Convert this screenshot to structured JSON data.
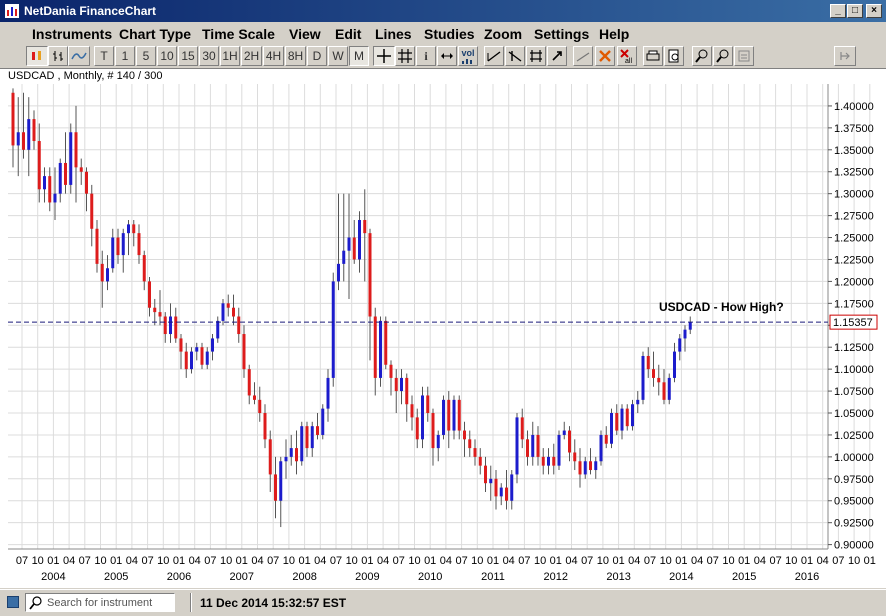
{
  "window": {
    "title": "NetDania FinanceChart"
  },
  "menu": [
    "Instruments",
    "Chart Type",
    "Time Scale",
    "View",
    "Edit",
    "Lines",
    "Studies",
    "Zoom",
    "Settings",
    "Help"
  ],
  "toolbar": {
    "timescale": [
      "T",
      "1",
      "5",
      "10",
      "15",
      "30",
      "1H",
      "2H",
      "4H",
      "8H",
      "D",
      "W",
      "M"
    ],
    "active_timescale": "M",
    "info_label": "i",
    "vol_label": "vol"
  },
  "instrument_label": "USDCAD , Monthly, # 140 / 300",
  "annotation": "USDCAD - How High?",
  "status": {
    "search_placeholder": "Search for instrument",
    "datetime": "11 Dec 2014 15:32:57 EST"
  },
  "colors": {
    "up": "#1c1ccc",
    "down": "#dd1c1c",
    "price_line": "#1a1a7a",
    "grid": "#dcdcdc",
    "price_box_border": "#cc0000"
  },
  "chart_data": {
    "type": "candlestick",
    "symbol": "USDCAD",
    "interval": "Monthly",
    "current_price": "1.15357",
    "y_ticks": [
      "1.40000",
      "1.37500",
      "1.35000",
      "1.32500",
      "1.30000",
      "1.27500",
      "1.25000",
      "1.22500",
      "1.20000",
      "1.17500",
      "1.15000",
      "1.12500",
      "1.10000",
      "1.07500",
      "1.05000",
      "1.02500",
      "1.00000",
      "0.97500",
      "0.95000",
      "0.92500",
      "0.90000"
    ],
    "ylim": [
      0.895,
      1.425
    ],
    "x_month_ticks": [
      "07",
      "10",
      "01",
      "04",
      "07",
      "10",
      "01",
      "04",
      "07",
      "10",
      "01",
      "04",
      "07",
      "10",
      "01",
      "04",
      "07",
      "10",
      "01",
      "04",
      "07",
      "10",
      "01",
      "04",
      "07",
      "10",
      "01",
      "04",
      "07",
      "10",
      "01",
      "04",
      "07",
      "10",
      "01",
      "04",
      "07",
      "10",
      "01",
      "04",
      "07",
      "10",
      "01",
      "04",
      "07",
      "10",
      "01",
      "04",
      "07",
      "10",
      "01",
      "04",
      "07",
      "10",
      "01"
    ],
    "x_year_ticks": [
      "2004",
      "2005",
      "2006",
      "2007",
      "2008",
      "2009",
      "2010",
      "2011",
      "2012",
      "2013",
      "2014",
      "2015",
      "2016"
    ],
    "candles": [
      [
        1.415,
        1.42,
        1.33,
        1.355
      ],
      [
        1.355,
        1.41,
        1.32,
        1.37
      ],
      [
        1.37,
        1.415,
        1.34,
        1.35
      ],
      [
        1.35,
        1.41,
        1.32,
        1.385
      ],
      [
        1.385,
        1.395,
        1.35,
        1.36
      ],
      [
        1.36,
        1.38,
        1.29,
        1.305
      ],
      [
        1.305,
        1.33,
        1.29,
        1.32
      ],
      [
        1.32,
        1.33,
        1.28,
        1.29
      ],
      [
        1.29,
        1.33,
        1.27,
        1.3
      ],
      [
        1.3,
        1.34,
        1.29,
        1.335
      ],
      [
        1.335,
        1.37,
        1.3,
        1.31
      ],
      [
        1.31,
        1.38,
        1.3,
        1.37
      ],
      [
        1.37,
        1.4,
        1.29,
        1.33
      ],
      [
        1.33,
        1.34,
        1.31,
        1.325
      ],
      [
        1.325,
        1.33,
        1.28,
        1.3
      ],
      [
        1.3,
        1.31,
        1.24,
        1.26
      ],
      [
        1.26,
        1.27,
        1.21,
        1.22
      ],
      [
        1.22,
        1.235,
        1.17,
        1.2
      ],
      [
        1.2,
        1.23,
        1.19,
        1.215
      ],
      [
        1.215,
        1.26,
        1.21,
        1.25
      ],
      [
        1.25,
        1.26,
        1.22,
        1.23
      ],
      [
        1.23,
        1.26,
        1.21,
        1.255
      ],
      [
        1.255,
        1.27,
        1.23,
        1.265
      ],
      [
        1.265,
        1.27,
        1.24,
        1.255
      ],
      [
        1.255,
        1.265,
        1.22,
        1.23
      ],
      [
        1.23,
        1.235,
        1.19,
        1.2
      ],
      [
        1.2,
        1.205,
        1.16,
        1.17
      ],
      [
        1.17,
        1.18,
        1.15,
        1.165
      ],
      [
        1.165,
        1.19,
        1.15,
        1.16
      ],
      [
        1.16,
        1.165,
        1.13,
        1.14
      ],
      [
        1.14,
        1.175,
        1.13,
        1.16
      ],
      [
        1.16,
        1.17,
        1.13,
        1.135
      ],
      [
        1.135,
        1.14,
        1.1,
        1.12
      ],
      [
        1.12,
        1.13,
        1.09,
        1.1
      ],
      [
        1.1,
        1.125,
        1.095,
        1.12
      ],
      [
        1.12,
        1.13,
        1.11,
        1.125
      ],
      [
        1.125,
        1.13,
        1.1,
        1.105
      ],
      [
        1.105,
        1.125,
        1.1,
        1.12
      ],
      [
        1.12,
        1.14,
        1.11,
        1.135
      ],
      [
        1.135,
        1.16,
        1.13,
        1.155
      ],
      [
        1.155,
        1.18,
        1.15,
        1.175
      ],
      [
        1.175,
        1.185,
        1.16,
        1.17
      ],
      [
        1.17,
        1.185,
        1.15,
        1.16
      ],
      [
        1.16,
        1.17,
        1.13,
        1.14
      ],
      [
        1.14,
        1.15,
        1.09,
        1.1
      ],
      [
        1.1,
        1.105,
        1.06,
        1.07
      ],
      [
        1.07,
        1.085,
        1.06,
        1.065
      ],
      [
        1.065,
        1.08,
        1.04,
        1.05
      ],
      [
        1.05,
        1.06,
        1.01,
        1.02
      ],
      [
        1.02,
        1.03,
        0.96,
        0.98
      ],
      [
        0.98,
        1.0,
        0.93,
        0.95
      ],
      [
        0.95,
        1.0,
        0.92,
        0.995
      ],
      [
        0.995,
        1.02,
        0.975,
        1.0
      ],
      [
        1.0,
        1.025,
        0.99,
        1.01
      ],
      [
        1.01,
        1.03,
        0.98,
        0.995
      ],
      [
        0.995,
        1.04,
        0.99,
        1.035
      ],
      [
        1.035,
        1.04,
        1.0,
        1.01
      ],
      [
        1.01,
        1.04,
        1.0,
        1.035
      ],
      [
        1.035,
        1.05,
        1.02,
        1.025
      ],
      [
        1.025,
        1.06,
        1.02,
        1.055
      ],
      [
        1.055,
        1.1,
        1.04,
        1.09
      ],
      [
        1.09,
        1.21,
        1.08,
        1.2
      ],
      [
        1.2,
        1.3,
        1.19,
        1.22
      ],
      [
        1.22,
        1.3,
        1.2,
        1.235
      ],
      [
        1.235,
        1.3,
        1.18,
        1.25
      ],
      [
        1.25,
        1.27,
        1.22,
        1.225
      ],
      [
        1.225,
        1.28,
        1.21,
        1.27
      ],
      [
        1.27,
        1.305,
        1.2,
        1.255
      ],
      [
        1.255,
        1.26,
        1.11,
        1.16
      ],
      [
        1.16,
        1.17,
        1.07,
        1.09
      ],
      [
        1.09,
        1.16,
        1.08,
        1.155
      ],
      [
        1.155,
        1.16,
        1.1,
        1.105
      ],
      [
        1.105,
        1.11,
        1.07,
        1.09
      ],
      [
        1.09,
        1.1,
        1.05,
        1.075
      ],
      [
        1.075,
        1.1,
        1.06,
        1.09
      ],
      [
        1.09,
        1.095,
        1.04,
        1.06
      ],
      [
        1.06,
        1.07,
        1.03,
        1.045
      ],
      [
        1.045,
        1.055,
        1.01,
        1.02
      ],
      [
        1.02,
        1.08,
        1.01,
        1.07
      ],
      [
        1.07,
        1.08,
        1.04,
        1.05
      ],
      [
        1.05,
        1.055,
        0.99,
        1.01
      ],
      [
        1.01,
        1.03,
        0.995,
        1.025
      ],
      [
        1.025,
        1.07,
        1.02,
        1.065
      ],
      [
        1.065,
        1.075,
        1.01,
        1.03
      ],
      [
        1.03,
        1.07,
        1.02,
        1.065
      ],
      [
        1.065,
        1.07,
        1.02,
        1.03
      ],
      [
        1.03,
        1.04,
        1.0,
        1.02
      ],
      [
        1.02,
        1.03,
        1.0,
        1.01
      ],
      [
        1.01,
        1.02,
        0.99,
        1.0
      ],
      [
        1.0,
        1.01,
        0.98,
        0.99
      ],
      [
        0.99,
        1.0,
        0.96,
        0.97
      ],
      [
        0.97,
        0.99,
        0.95,
        0.975
      ],
      [
        0.975,
        0.985,
        0.94,
        0.955
      ],
      [
        0.955,
        0.97,
        0.945,
        0.965
      ],
      [
        0.965,
        0.985,
        0.94,
        0.95
      ],
      [
        0.95,
        0.985,
        0.94,
        0.98
      ],
      [
        0.98,
        1.05,
        0.97,
        1.045
      ],
      [
        1.045,
        1.055,
        1.01,
        1.02
      ],
      [
        1.02,
        1.03,
        0.99,
        1.0
      ],
      [
        1.0,
        1.04,
        0.99,
        1.025
      ],
      [
        1.025,
        1.035,
        0.99,
        1.0
      ],
      [
        1.0,
        1.01,
        0.98,
        0.99
      ],
      [
        0.99,
        1.01,
        0.98,
        1.0
      ],
      [
        1.0,
        1.015,
        0.98,
        0.99
      ],
      [
        0.99,
        1.03,
        0.985,
        1.025
      ],
      [
        1.025,
        1.04,
        1.02,
        1.03
      ],
      [
        1.03,
        1.035,
        0.995,
        1.005
      ],
      [
        1.005,
        1.02,
        0.985,
        0.995
      ],
      [
        0.995,
        1.01,
        0.965,
        0.98
      ],
      [
        0.98,
        1.0,
        0.975,
        0.995
      ],
      [
        0.995,
        1.01,
        0.98,
        0.985
      ],
      [
        0.985,
        1.0,
        0.975,
        0.995
      ],
      [
        0.995,
        1.03,
        0.99,
        1.025
      ],
      [
        1.025,
        1.035,
        1.01,
        1.015
      ],
      [
        1.015,
        1.055,
        1.01,
        1.05
      ],
      [
        1.05,
        1.06,
        1.025,
        1.03
      ],
      [
        1.03,
        1.06,
        1.02,
        1.055
      ],
      [
        1.055,
        1.06,
        1.03,
        1.035
      ],
      [
        1.035,
        1.065,
        1.03,
        1.06
      ],
      [
        1.06,
        1.075,
        1.05,
        1.065
      ],
      [
        1.065,
        1.12,
        1.06,
        1.115
      ],
      [
        1.115,
        1.125,
        1.09,
        1.1
      ],
      [
        1.1,
        1.12,
        1.08,
        1.09
      ],
      [
        1.09,
        1.105,
        1.07,
        1.085
      ],
      [
        1.085,
        1.1,
        1.06,
        1.065
      ],
      [
        1.065,
        1.095,
        1.06,
        1.09
      ],
      [
        1.09,
        1.13,
        1.085,
        1.12
      ],
      [
        1.12,
        1.14,
        1.11,
        1.135
      ],
      [
        1.135,
        1.15,
        1.12,
        1.145
      ],
      [
        1.145,
        1.16,
        1.14,
        1.15357
      ]
    ]
  }
}
